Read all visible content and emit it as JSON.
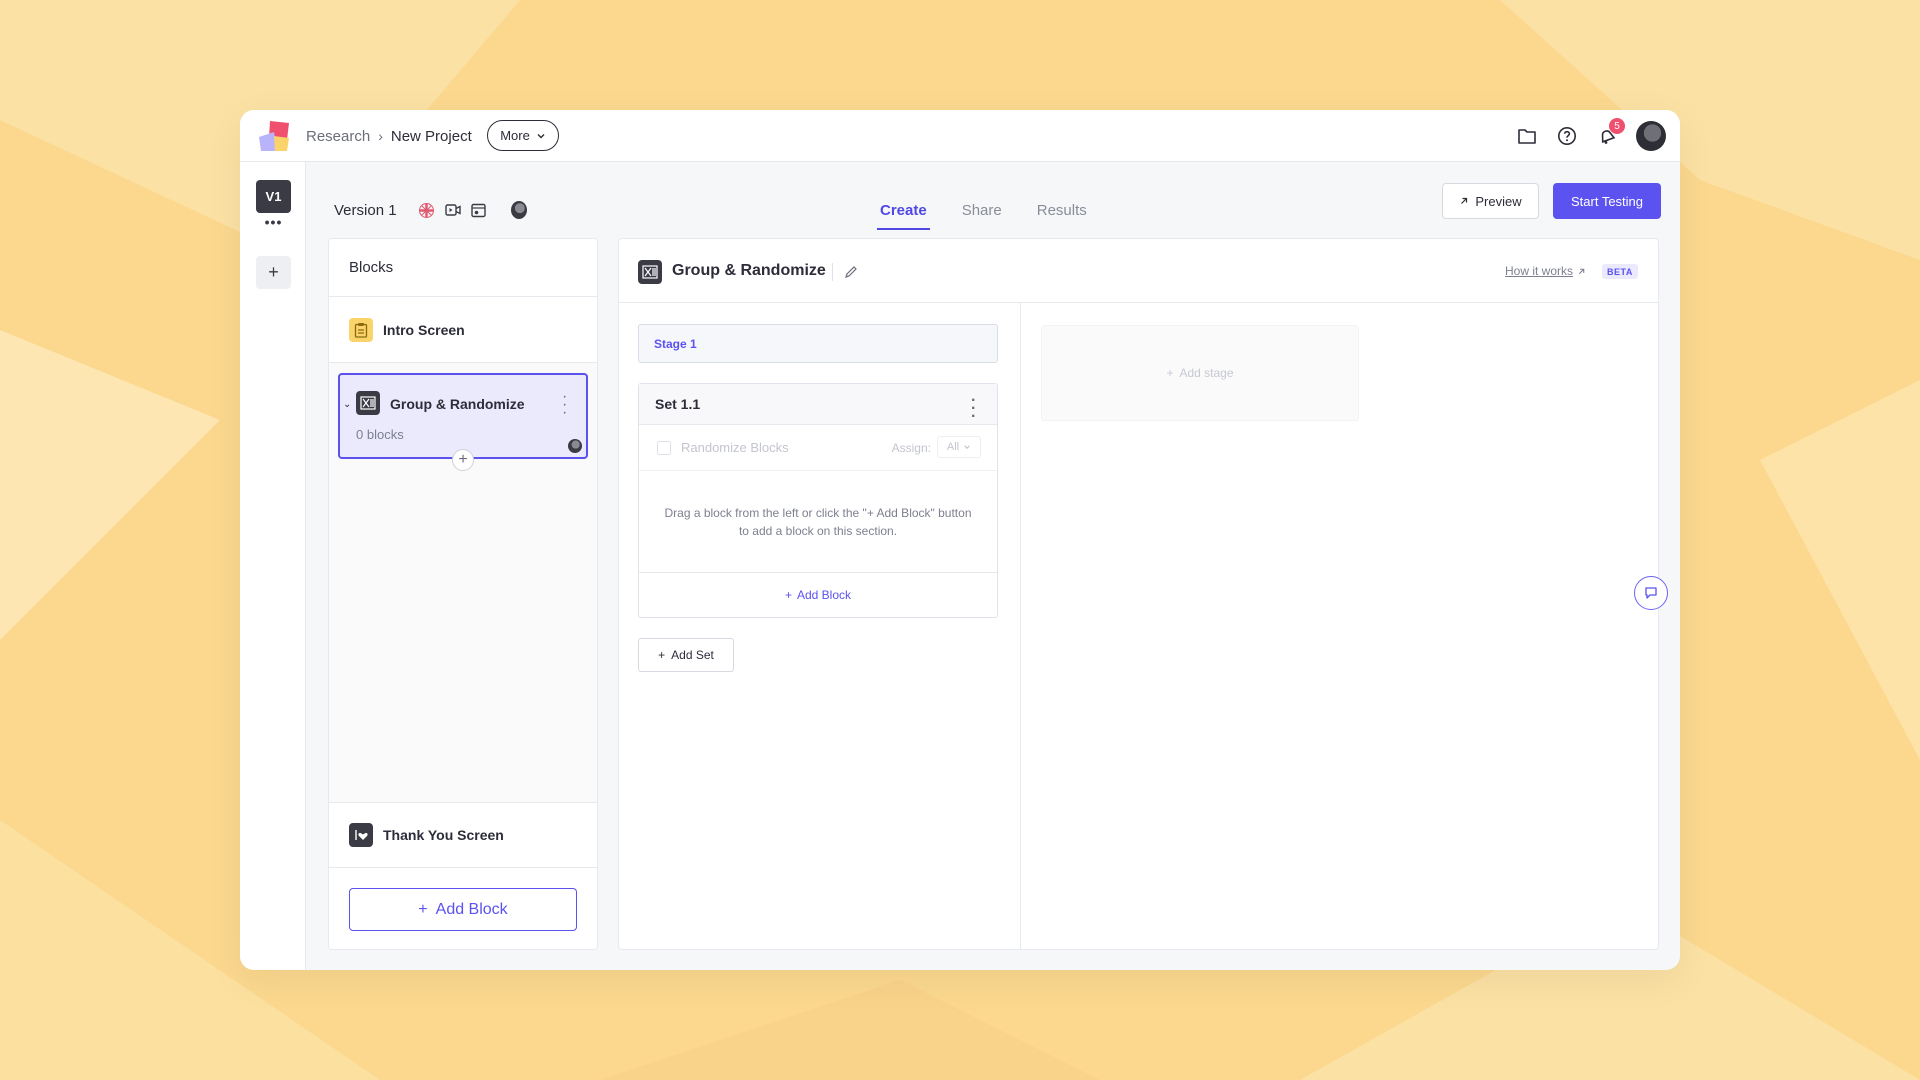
{
  "breadcrumb": {
    "root": "Research",
    "current": "New Project"
  },
  "more_button": "More",
  "notifications": {
    "count": "5"
  },
  "rail": {
    "version_badge": "V1",
    "dots": "•••",
    "add": "+"
  },
  "version": {
    "label": "Version 1"
  },
  "tabs": [
    {
      "label": "Create",
      "active": true
    },
    {
      "label": "Share",
      "active": false
    },
    {
      "label": "Results",
      "active": false
    }
  ],
  "actions": {
    "preview": "Preview",
    "start": "Start Testing"
  },
  "blocks_panel": {
    "title": "Blocks",
    "intro": "Intro Screen",
    "group": {
      "title": "Group & Randomize",
      "count": "0 blocks"
    },
    "thank_you": "Thank You Screen",
    "add_block": "Add Block"
  },
  "editor": {
    "title": "Group & Randomize",
    "how_it_works": "How it works",
    "beta": "BETA",
    "stage": "Stage 1",
    "set": {
      "title": "Set 1.1",
      "randomize": "Randomize Blocks",
      "assign_label": "Assign:",
      "assign_value": "All",
      "hint": "Drag a block from the left or click the \"+ Add Block\" button to add a block on this section.",
      "add_block": "Add Block"
    },
    "add_set": "Add Set",
    "add_stage": "Add stage"
  },
  "colors": {
    "accent": "#5b52f0",
    "badge": "#f0506e",
    "background": "#fbd88e"
  }
}
